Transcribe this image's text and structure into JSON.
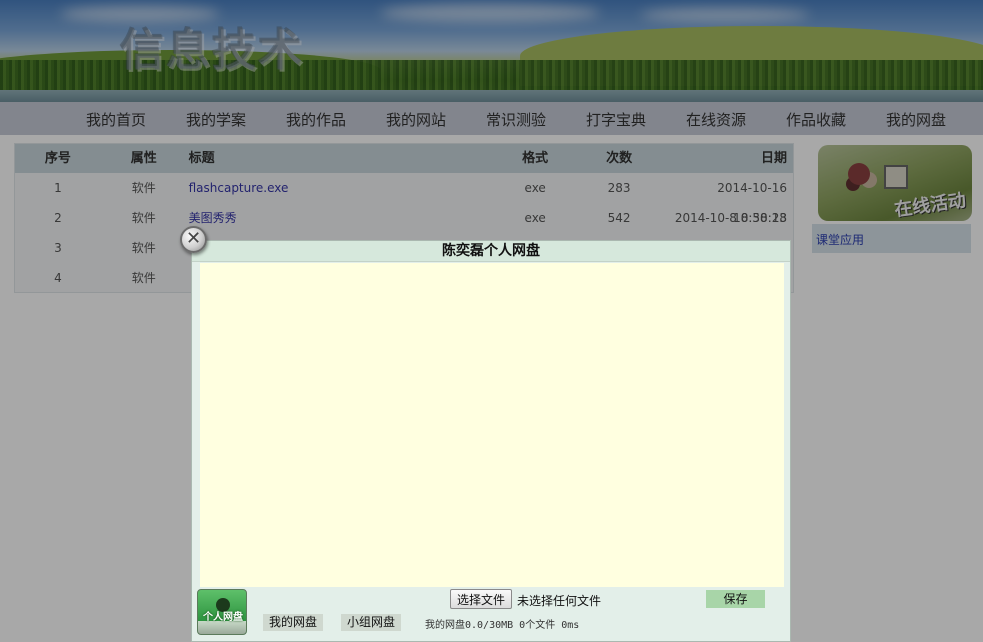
{
  "banner": {
    "logo_text": "信息技术"
  },
  "nav": {
    "items": [
      "我的首页",
      "我的学案",
      "我的作品",
      "我的网站",
      "常识测验",
      "打字宝典",
      "在线资源",
      "作品收藏",
      "我的网盘"
    ]
  },
  "table": {
    "headers": {
      "no": "序号",
      "attr": "属性",
      "title": "标题",
      "format": "格式",
      "count": "次数",
      "date": "日期"
    },
    "rows": [
      {
        "no": "1",
        "attr": "软件",
        "title": "flashcapture.exe",
        "format": "exe",
        "count": "283",
        "date": "2014-10-16 10:30:18"
      },
      {
        "no": "2",
        "attr": "软件",
        "title": "美图秀秀",
        "format": "exe",
        "count": "542",
        "date": "2014-10-8 8:58:23"
      },
      {
        "no": "3",
        "attr": "软件",
        "title": "",
        "format": "",
        "count": "",
        "date": ""
      },
      {
        "no": "4",
        "attr": "软件",
        "title": "",
        "format": "",
        "count": "",
        "date": ""
      }
    ]
  },
  "side": {
    "stamp_text": "在线活动",
    "link": "课堂应用"
  },
  "dialog": {
    "title": "陈奕磊个人网盘",
    "close_glyph": "✕",
    "logo_text": "个人网盘",
    "file_button": "选择文件",
    "file_status": "未选择任何文件",
    "save_label": "保存",
    "tab_my_disk": "我的网盘",
    "tab_group_disk": "小组网盘",
    "disk_info": "我的网盘0.0/30MB 0个文件 0ms"
  }
}
